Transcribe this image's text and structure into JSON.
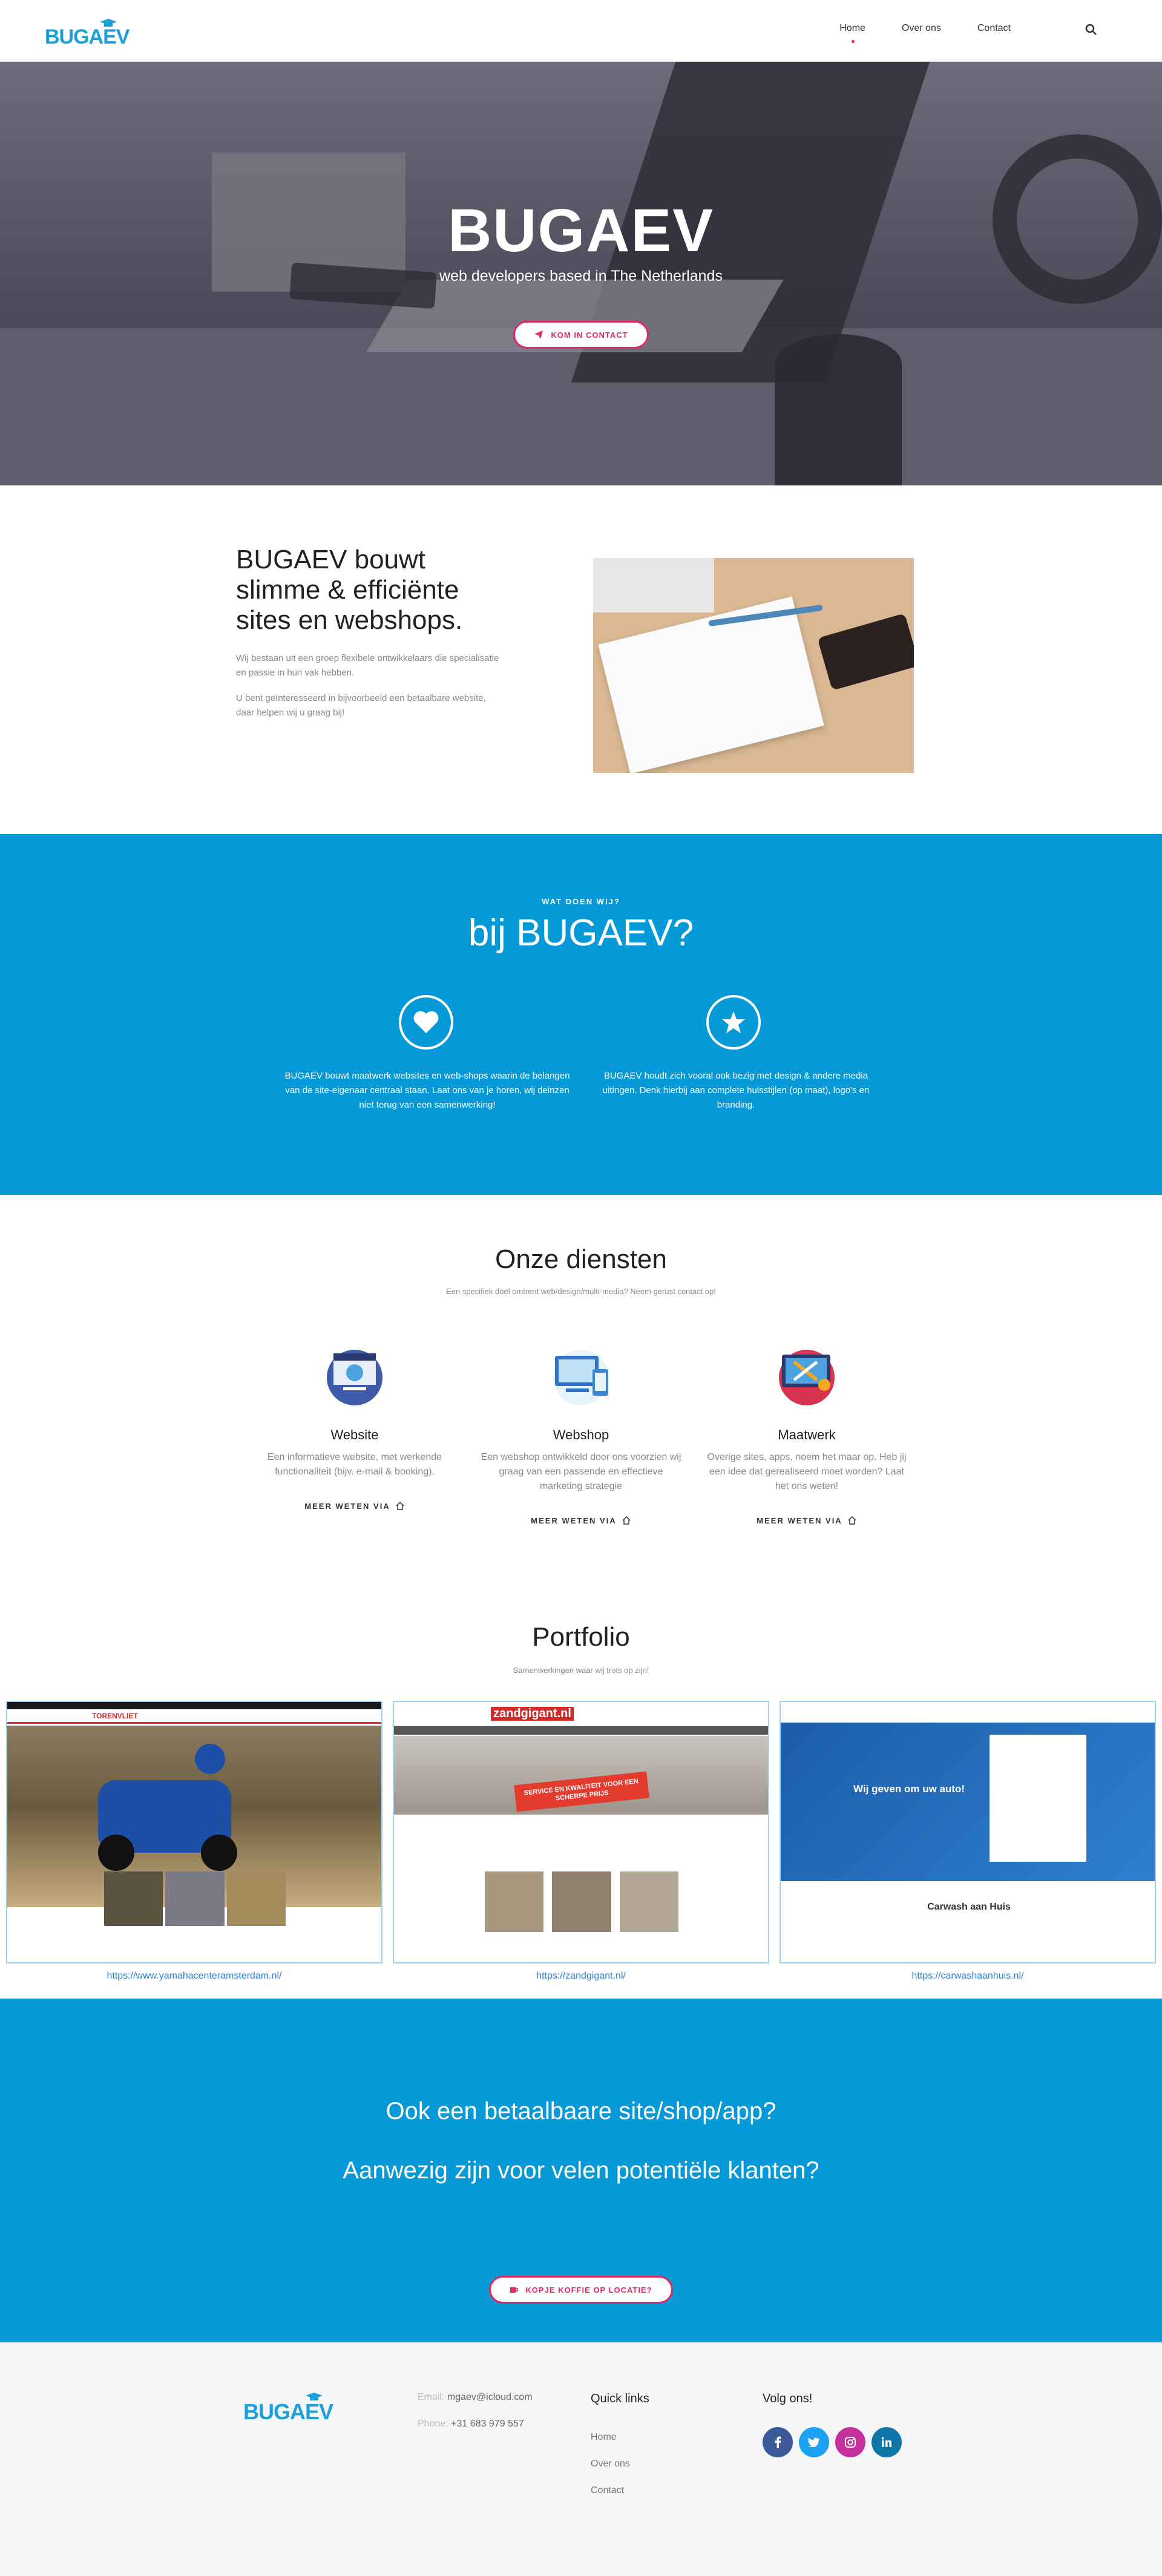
{
  "nav": {
    "logo": "BUGAEV",
    "links": [
      "Home",
      "Over ons",
      "Contact"
    ],
    "active": "Home"
  },
  "hero": {
    "title": "BUGAEV",
    "subtitle": "web developers based in The Netherlands",
    "cta": "KOM IN CONTACT"
  },
  "intro": {
    "title": "BUGAEV bouwt slimme & efficiënte sites en webshops.",
    "p1": "Wij bestaan uit een groep flexibele ontwikkelaars die specialisatie en passie in hun vak hebben.",
    "p2": "U bent geïnteresseerd in bijvoorbeeld een betaalbare website, daar helpen wij u graag bij!"
  },
  "what": {
    "kicker": "WAT DOEN WIJ?",
    "title": "bij BUGAEV?",
    "left_text": "BUGAEV bouwt maatwerk websites en web-shops waarin de belangen van de site-eigenaar centraal staan. Laat ons van je horen, wij deinzen niet terug van een samenwerking!",
    "right_text": "BUGAEV houdt zich vooral ook bezig met design & andere media uitingen. Denk hierbij aan complete huisstijlen (op maat), logo's en branding."
  },
  "services": {
    "title": "Onze diensten",
    "subtitle": "Een specifiek doel omtrent web/design/multi-media? Neem gerust contact op!",
    "items": [
      {
        "title": "Website",
        "desc": "Een informatieve website, met werkende functionaliteit (bijv. e-mail & booking).",
        "link": "MEER WETEN VIA"
      },
      {
        "title": "Webshop",
        "desc": "Een webshop ontwikkeld door ons voorzien wij graag van een passende en effectieve marketing strategie",
        "link": "MEER WETEN VIA"
      },
      {
        "title": "Maatwerk",
        "desc": "Overige sites, apps, noem het maar op. Heb jij een idee dat gerealiseerd moet worden? Laat het ons weten!",
        "link": "MEER WETEN VIA"
      }
    ]
  },
  "portfolio": {
    "title": "Portfolio",
    "subtitle": "Samenwerkingen waar wij trots op zijn!",
    "items": [
      {
        "url": "https://www.yamahacenteramsterdam.nl/",
        "brand": "TORENVLIET"
      },
      {
        "url": "https://zandgigant.nl/",
        "brand": "zandgigant.nl",
        "banner": "SERVICE EN KWALITEIT VOOR EEN SCHERPE PRIJS"
      },
      {
        "url": "https://carwashaanhuis.nl/",
        "headline": "Wij geven om uw auto!",
        "footer_title": "Carwash aan Huis"
      }
    ]
  },
  "cta": {
    "line1": "Ook een betaalbaare site/shop/app?",
    "line2": "Aanwezig zijn voor velen potentiële klanten?",
    "button": "KOPJE KOFFIE OP LOCATIE?"
  },
  "footer": {
    "logo": "BUGAEV",
    "email_label": "Email:",
    "email": "mgaev@icloud.com",
    "phone_label": "Phone:",
    "phone": "+31 683 979 557",
    "quick_title": "Quick links",
    "quick_links": [
      "Home",
      "Over ons",
      "Contact"
    ],
    "social_title": "Volg ons!"
  },
  "colors": {
    "brand_blue": "#059ad7",
    "accent_pink": "#e0295d"
  }
}
